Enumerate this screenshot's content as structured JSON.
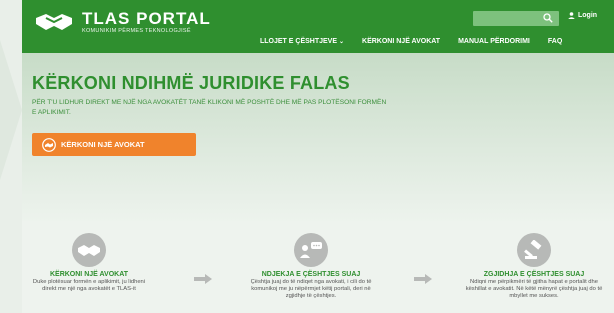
{
  "header": {
    "logo_title": "TLAS PORTAL",
    "logo_subtitle": "KOMUNIKIM PËRMES TEKNOLOGJISË",
    "search": {
      "value": "",
      "placeholder": ""
    },
    "login_label": "Login"
  },
  "nav": {
    "items": [
      {
        "label": "LLOJET E ÇËSHTJEVE"
      },
      {
        "label": "KËRKONI NJË AVOKAT"
      },
      {
        "label": "MANUAL PËRDORIMI"
      },
      {
        "label": "FAQ"
      }
    ]
  },
  "hero": {
    "title": "KËRKONI NDIHMË JURIDIKE FALAS",
    "text": "PËR T'U LIDHUR DIREKT ME NJË NGA AVOKATËT TANË KLIKONI MË POSHTË DHE MË PAS PLOTËSONI FORMËN E APLIKIMIT.",
    "cta_label": "KËRKONI NJË AVOKAT"
  },
  "steps": [
    {
      "title": "KËRKONI NJË AVOKAT",
      "desc": "Duke plotësuar formën e aplikimit, ju lidheni direkt me një nga avokatët e TLAS-it"
    },
    {
      "title": "NDJEKJA E ÇËSHTJES SUAJ",
      "desc": "Çështja juaj do të ndiqet nga avokati, i cili do të komunikoj me ju nëpërmjet këtij portali, deri në zgjidhje të çështjes."
    },
    {
      "title": "ZGJIDHJA E ÇËSHTJES SUAJ",
      "desc": "Ndiqni me përpikmëri të gjitha hapat e portalit dhe këshillat e avokatit. Në këtë mënyrë çështja juaj do të mbyllet me sukses."
    }
  ],
  "colors": {
    "brand_green": "#2f8f2f",
    "cta_orange": "#f0832c",
    "step_circle": "#b7b9b7"
  },
  "icons": [
    "handshake-icon",
    "search-icon",
    "user-icon",
    "chevron-down-icon",
    "people-chat-icon",
    "gavel-icon",
    "arrow-right-icon"
  ]
}
